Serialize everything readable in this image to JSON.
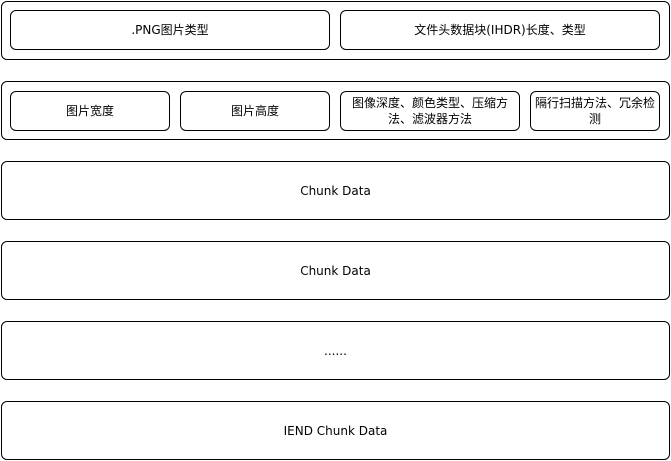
{
  "diagram": {
    "header_row": {
      "cells": [
        ".PNG图片类型",
        "文件头数据块(IHDR)长度、类型"
      ]
    },
    "ihdr_row": {
      "cells": [
        "图片宽度",
        "图片高度",
        "图像深度、颜色类型、压缩方法、滤波器方法",
        "隔行扫描方法、冗余检测"
      ]
    },
    "chunk_rows": [
      "Chunk Data",
      "Chunk Data",
      "......",
      "IEND Chunk Data"
    ]
  }
}
